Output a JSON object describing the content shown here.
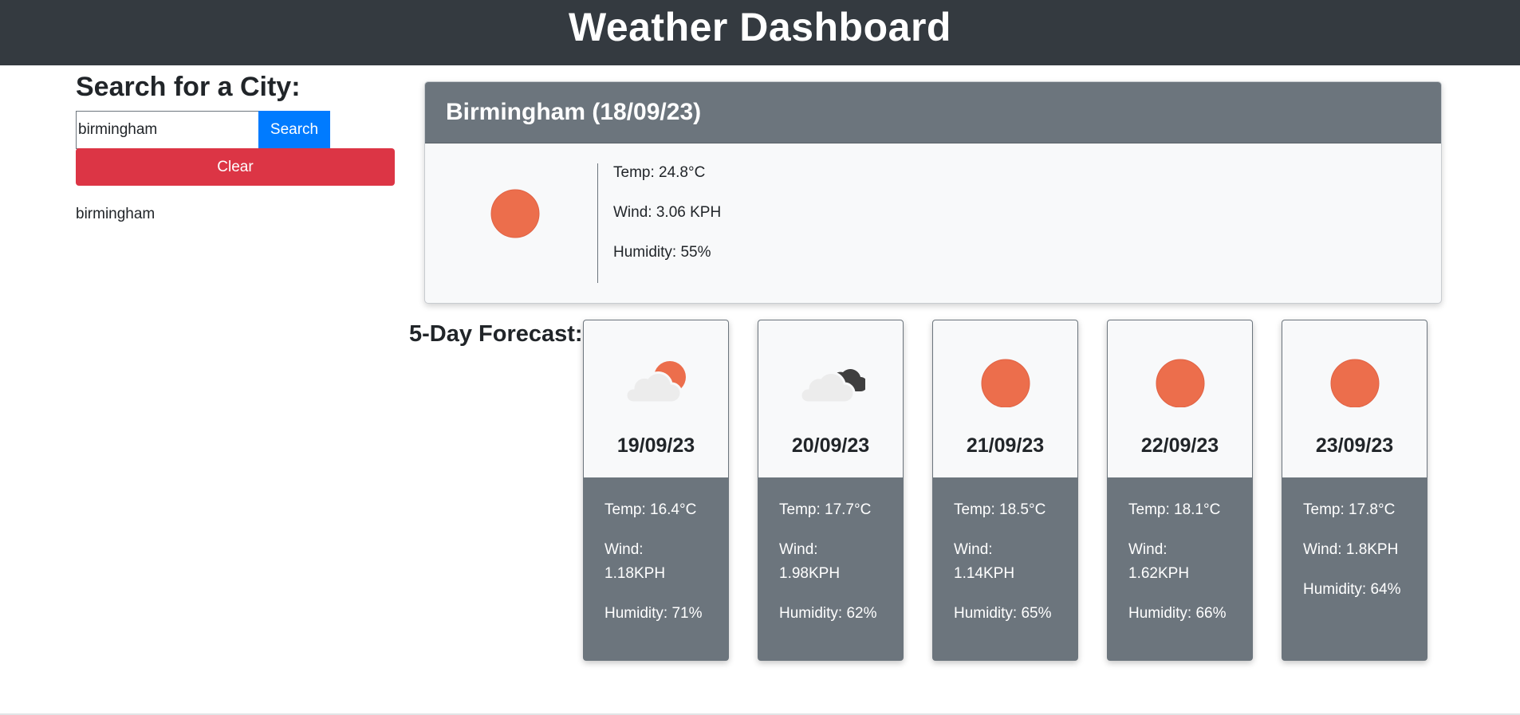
{
  "header": {
    "title": "Weather Dashboard"
  },
  "search": {
    "heading": "Search for a City:",
    "input_value": "birmingham",
    "search_label": "Search",
    "clear_label": "Clear",
    "history": [
      "birmingham"
    ]
  },
  "current": {
    "title": "Birmingham (18/09/23)",
    "icon": "sun-icon",
    "temp": "Temp: 24.8°C",
    "wind": "Wind: 3.06 KPH",
    "humidity": "Humidity: 55%"
  },
  "forecast": {
    "heading": "5-Day Forecast:",
    "days": [
      {
        "date": "19/09/23",
        "icon": "partly-cloudy-icon",
        "temp": "Temp: 16.4°C",
        "wind": "Wind: 1.18KPH",
        "humidity": "Humidity: 71%"
      },
      {
        "date": "20/09/23",
        "icon": "cloudy-icon",
        "temp": "Temp: 17.7°C",
        "wind": "Wind: 1.98KPH",
        "humidity": "Humidity: 62%"
      },
      {
        "date": "21/09/23",
        "icon": "sun-icon",
        "temp": "Temp: 18.5°C",
        "wind": "Wind: 1.14KPH",
        "humidity": "Humidity: 65%"
      },
      {
        "date": "22/09/23",
        "icon": "sun-icon",
        "temp": "Temp: 18.1°C",
        "wind": "Wind: 1.62KPH",
        "humidity": "Humidity: 66%"
      },
      {
        "date": "23/09/23",
        "icon": "sun-icon",
        "temp": "Temp: 17.8°C",
        "wind": "Wind: 1.8KPH",
        "humidity": "Humidity: 64%"
      }
    ]
  },
  "colors": {
    "header_bg": "#343a40",
    "accent_blue": "#007bff",
    "danger_red": "#dc3545",
    "card_gray": "#6c757d",
    "sun": "#ec6e4c"
  }
}
